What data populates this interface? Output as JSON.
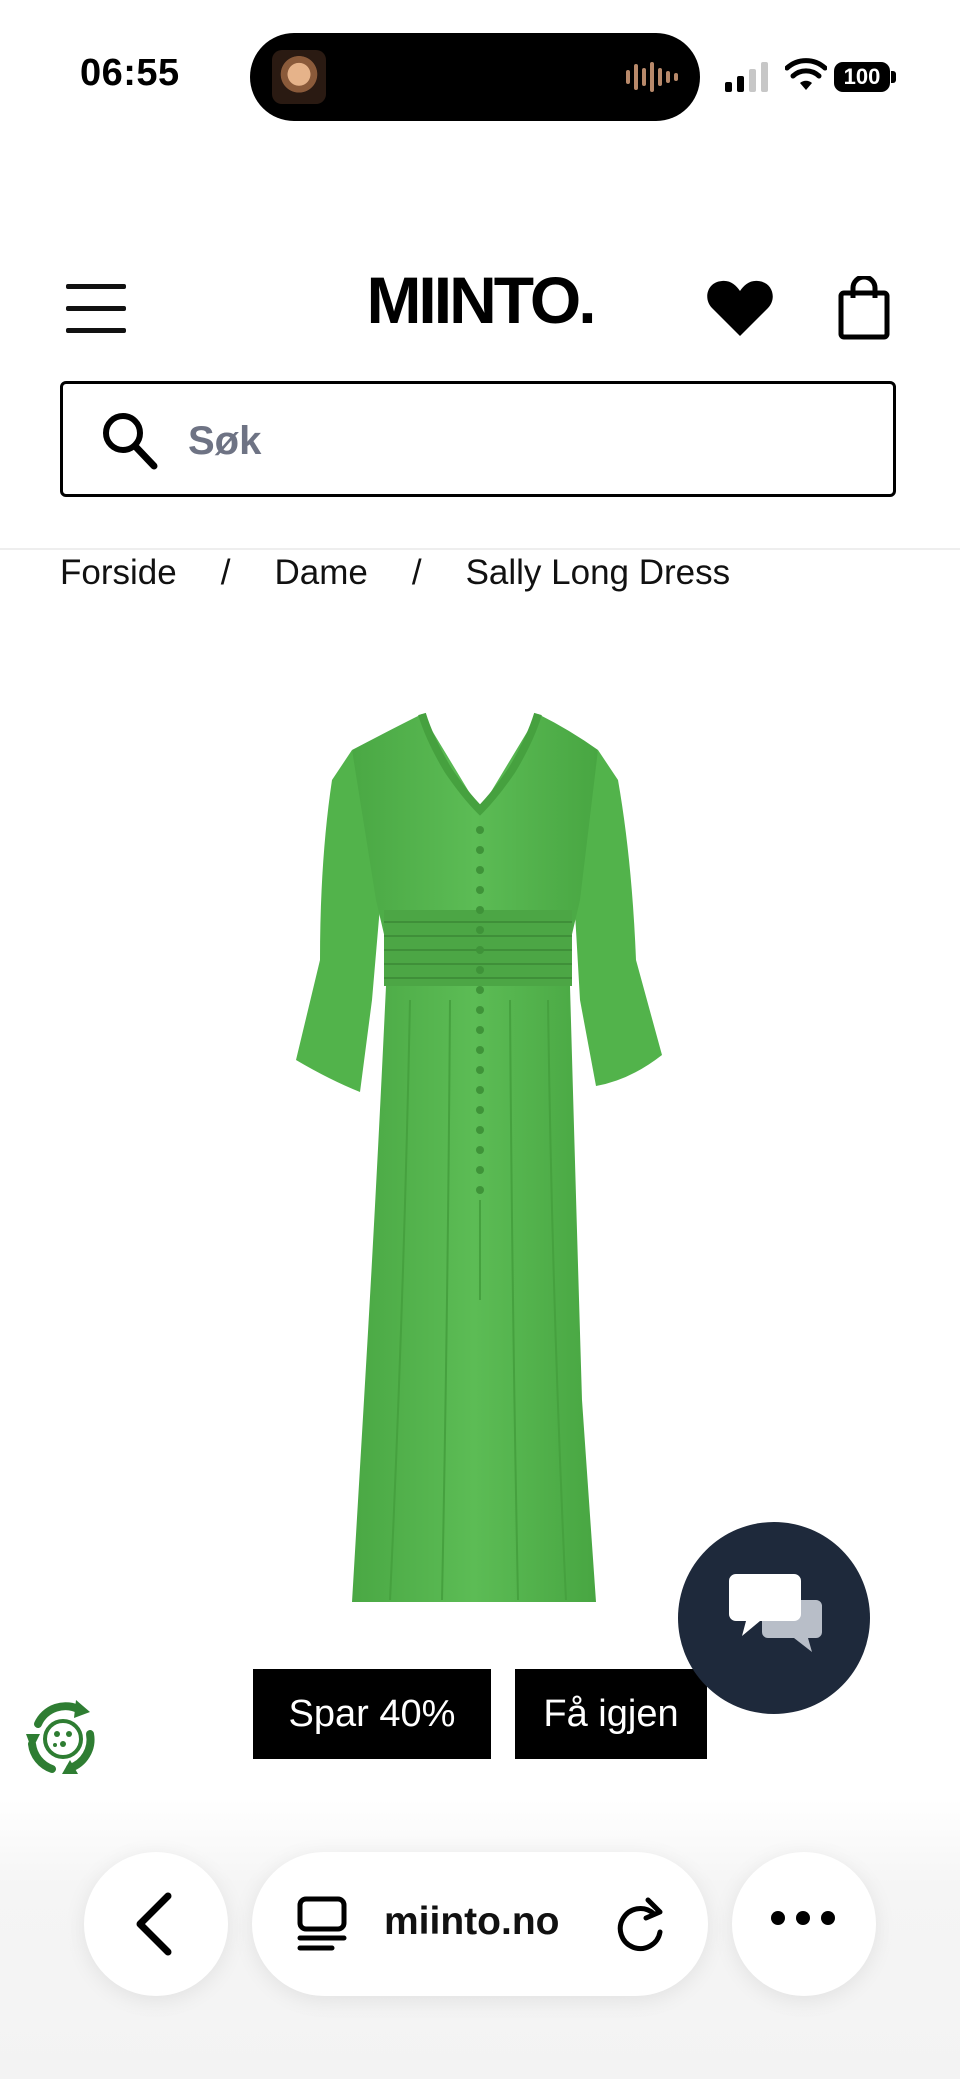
{
  "status_bar": {
    "time": "06:55",
    "battery": "100"
  },
  "header": {
    "logo": "MIINTO.",
    "icons": [
      "menu-icon",
      "heart-icon",
      "shopping-bag-icon"
    ]
  },
  "search": {
    "placeholder": "Søk",
    "value": ""
  },
  "breadcrumb": {
    "items": [
      "Forside",
      "Dame",
      "Sally Long Dress"
    ],
    "separator": "/"
  },
  "product": {
    "image_color": "#55b84f",
    "badges": [
      "Spar 40%",
      "Få igjen"
    ]
  },
  "browser_bar": {
    "url": "miinto.no"
  },
  "colors": {
    "chat_button": "#1e293b",
    "eco_green": "#2e7d32"
  }
}
